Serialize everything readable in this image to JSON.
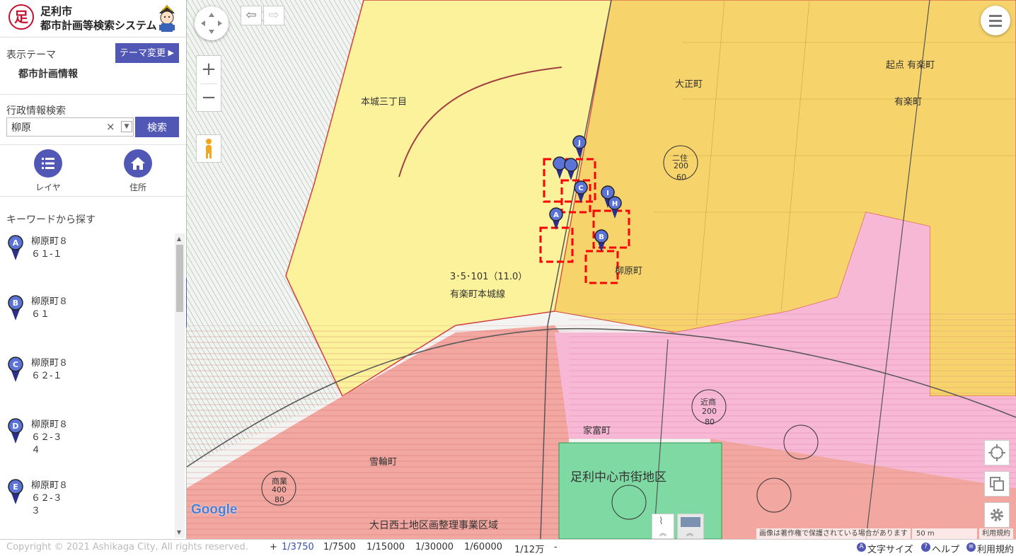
{
  "header": {
    "logo_glyph": "足",
    "city": "足利市",
    "system": "都市計画等検索システム"
  },
  "theme": {
    "label": "表示テーマ",
    "button": "テーマ変更",
    "current": "都市計画情報"
  },
  "admin_search": {
    "label": "行政情報検索",
    "value": "柳原",
    "clear": "×",
    "dropdown": "▼",
    "button": "検索"
  },
  "actions": {
    "layer": "レイヤ",
    "address": "住所"
  },
  "keyword": {
    "label": "キーワードから探す"
  },
  "results": [
    {
      "pin": "A",
      "line1": "柳原町８",
      "line2": "６１-１",
      "line3": ""
    },
    {
      "pin": "B",
      "line1": "柳原町８",
      "line2": "６１",
      "line3": ""
    },
    {
      "pin": "C",
      "line1": "柳原町８",
      "line2": "６２-１",
      "line3": ""
    },
    {
      "pin": "D",
      "line1": "柳原町８",
      "line2": "６２-３",
      "line3": "４"
    },
    {
      "pin": "E",
      "line1": "柳原町８",
      "line2": "６２-３",
      "line3": "３"
    }
  ],
  "collapse_glyph": "«",
  "map": {
    "labels": {
      "honjo": "本城三丁目",
      "route_num": "3･5･101（11.0）",
      "route_name": "有楽町本城線",
      "yanagihara": "柳原町",
      "taisho": "大正町",
      "yuraku": "有楽町",
      "district": "足利中心市街地区",
      "project": "大日西土地区画整理事業区域",
      "yukiwa": "雪輪町",
      "ieTomi": "家富町",
      "kiten": "起点 有楽町",
      "zone_2ju": "二住",
      "zone_kinsho": "近商",
      "zone_shogyo": "商業"
    },
    "zone_values": {
      "a": "200",
      "b": "60",
      "c": "200",
      "d": "80",
      "e": "400",
      "f": "80"
    },
    "pins": [
      "J",
      "C",
      "I",
      "H",
      "A",
      "B"
    ],
    "google": "Google",
    "copyright_note": "画像は著作権で保護されている場合があります",
    "scale_text": "50 m",
    "terms": "利用規約"
  },
  "footer": {
    "copyright": "Copyright © 2021 Ashikaga City, All rights reserved.",
    "plus": "+",
    "scales": [
      "1/3750",
      "1/7500",
      "1/15000",
      "1/30000",
      "1/60000",
      "1/12万"
    ],
    "minus": "-",
    "font_size": "文字サイズ",
    "help": "ヘルプ",
    "terms": "利用規約"
  },
  "colors": {
    "accent": "#5157b5",
    "yellow_zone": "#fbf29b",
    "orange_zone": "#f6d36b",
    "red_zone": "#f2a8a0",
    "pink_zone": "#f7b8d6",
    "green_zone": "#7fd9a3",
    "highlight": "#ff0000"
  }
}
